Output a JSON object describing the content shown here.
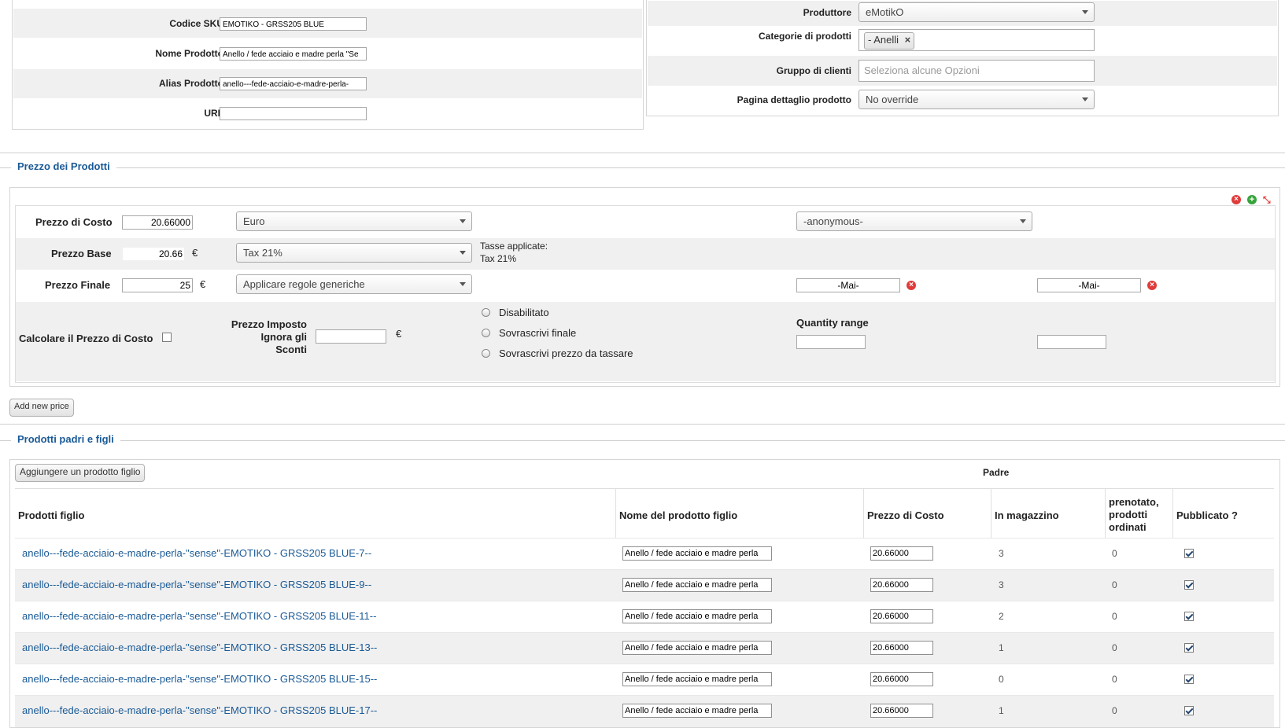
{
  "product": {
    "sku_label": "Codice SKU",
    "sku_value": "EMOTIKO - GRSS205 BLUE",
    "name_label": "Nome Prodotto",
    "name_value": "Anello / fede acciaio e madre perla \"Se",
    "alias_label": "Alias Prodotto",
    "alias_value": "anello---fede-acciaio-e-madre-perla-",
    "url_label": "URL",
    "url_value": ""
  },
  "meta": {
    "manufacturer_label": "Produttore",
    "manufacturer_value": "eMotikO",
    "categories_label": "Categorie di prodotti",
    "category_chip": "- Anelli",
    "chip_remove": "×",
    "customer_group_label": "Gruppo di clienti",
    "customer_group_placeholder": "Seleziona alcune Opzioni",
    "detail_page_label": "Pagina dettaglio prodotto",
    "detail_page_value": "No override"
  },
  "prices": {
    "legend": "Prezzo dei Prodotti",
    "cost_label": "Prezzo di Costo",
    "cost_value": "20.66000",
    "currency_select": "Euro",
    "shopper_group_select": "-anonymous-",
    "base_label": "Prezzo Base",
    "base_value": "20.66",
    "base_currency": "€",
    "tax_select": "Tax 21%",
    "taxes_applied_label": "Tasse applicate:",
    "taxes_applied_value": "Tax 21%",
    "final_label": "Prezzo Finale",
    "final_value": "25",
    "final_currency": "€",
    "rules_select": "Applicare regole generiche",
    "date_from": "-Mai-",
    "date_to": "-Mai-",
    "calc_cost_label": "Calcolare il Prezzo di Costo",
    "override_label_1": "Prezzo Imposto",
    "override_label_2": "Ignora gli",
    "override_label_3": "Sconti",
    "override_currency": "€",
    "radio_disabled": "Disabilitato",
    "radio_final": "Sovrascrivi finale",
    "radio_taxable": "Sovrascrivi prezzo da tassare",
    "quantity_range_label": "Quantity range",
    "add_price_button": "Add new price"
  },
  "children": {
    "legend": "Prodotti padri e figli",
    "add_child_button": "Aggiungere un prodotto figlio",
    "parent_label": "Padre",
    "headers": {
      "child": "Prodotti figlio",
      "child_name": "Nome del prodotto figlio",
      "cost": "Prezzo di Costo",
      "stock": "In magazzino",
      "reserved_1": "prenotato,",
      "reserved_2": "prodotti",
      "reserved_3": "ordinati",
      "published": "Pubblicato ?"
    },
    "rows": [
      {
        "link": "anello---fede-acciaio-e-madre-perla-\"sense\"-EMOTIKO - GRSS205 BLUE-7--",
        "name": "Anello / fede acciaio e madre perla",
        "cost": "20.66000",
        "stock": "3",
        "ordered": "0",
        "published": true
      },
      {
        "link": "anello---fede-acciaio-e-madre-perla-\"sense\"-EMOTIKO - GRSS205 BLUE-9--",
        "name": "Anello / fede acciaio e madre perla",
        "cost": "20.66000",
        "stock": "3",
        "ordered": "0",
        "published": true
      },
      {
        "link": "anello---fede-acciaio-e-madre-perla-\"sense\"-EMOTIKO - GRSS205 BLUE-11--",
        "name": "Anello / fede acciaio e madre perla",
        "cost": "20.66000",
        "stock": "2",
        "ordered": "0",
        "published": true
      },
      {
        "link": "anello---fede-acciaio-e-madre-perla-\"sense\"-EMOTIKO - GRSS205 BLUE-13--",
        "name": "Anello / fede acciaio e madre perla",
        "cost": "20.66000",
        "stock": "1",
        "ordered": "0",
        "published": true
      },
      {
        "link": "anello---fede-acciaio-e-madre-perla-\"sense\"-EMOTIKO - GRSS205 BLUE-15--",
        "name": "Anello / fede acciaio e madre perla",
        "cost": "20.66000",
        "stock": "0",
        "ordered": "0",
        "published": true
      },
      {
        "link": "anello---fede-acciaio-e-madre-perla-\"sense\"-EMOTIKO - GRSS205 BLUE-17--",
        "name": "Anello / fede acciaio e madre perla",
        "cost": "20.66000",
        "stock": "1",
        "ordered": "0",
        "published": true
      }
    ]
  },
  "colors": {
    "link": "#1a5a96",
    "legend": "#1a5a96",
    "row_shade": "#f0f0f0",
    "remove_icon": "#e03b3b",
    "add_icon": "#37a43b"
  }
}
